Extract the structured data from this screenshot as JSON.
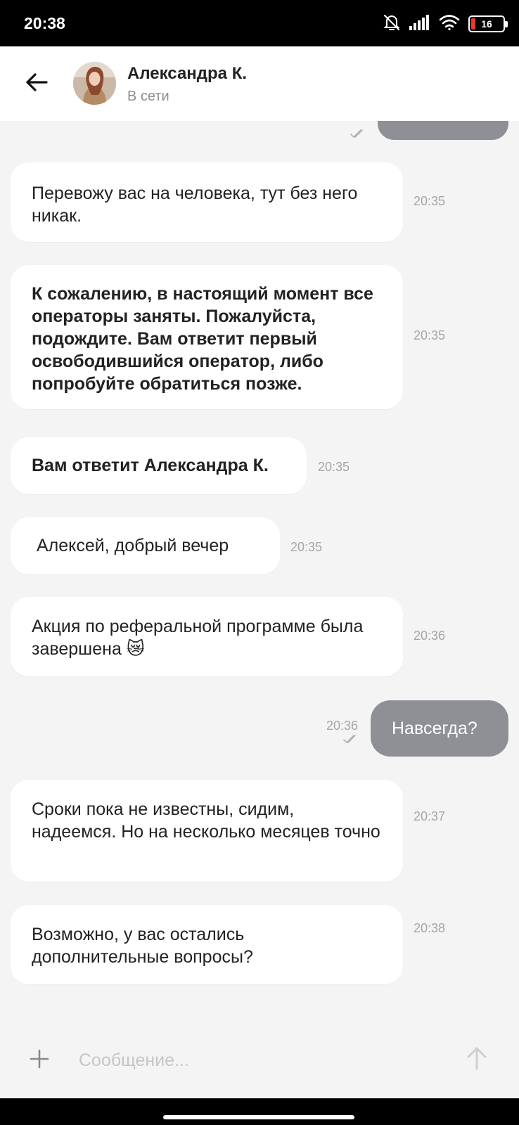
{
  "status_bar": {
    "time": "20:38",
    "battery_level": "16",
    "icons": [
      "bell-off-icon",
      "signal-icon",
      "wifi-icon",
      "battery-icon"
    ]
  },
  "header": {
    "contact_name": "Александра К.",
    "contact_status": "В сети",
    "back_icon": "arrow-left-icon"
  },
  "messages": [
    {
      "direction": "out",
      "text": "",
      "partially_visible": true
    },
    {
      "direction": "in",
      "text": "Перевожу вас на человека, тут без него никак.",
      "time": "20:35",
      "bold": false
    },
    {
      "direction": "in",
      "text": "К сожалению, в настоящий момент все операторы заняты. Пожалуйста, подождите. Вам ответит первый освободившийся оператор, либо попробуйте обратиться позже.",
      "time": "20:35",
      "bold": true
    },
    {
      "direction": "in",
      "text": "Вам ответит Александра К.",
      "time": "20:35",
      "bold": true
    },
    {
      "direction": "in",
      "text": "Алексей, добрый вечер",
      "time": "20:35",
      "bold": false
    },
    {
      "direction": "in",
      "text": "Акция по реферальной программе была завершена 😿",
      "time": "20:36",
      "bold": false
    },
    {
      "direction": "out",
      "text": "Навсегда?",
      "time": "20:36",
      "read": true
    },
    {
      "direction": "in",
      "text": "Сроки пока не известны, сидим, надеемся. Но на несколько месяцев точно",
      "time": "20:37",
      "bold": false
    },
    {
      "direction": "in",
      "text": "Возможно, у вас остались дополнительные вопросы?",
      "time": "20:38",
      "bold": false
    }
  ],
  "composer": {
    "placeholder": "Сообщение...",
    "value": "",
    "attach_icon": "plus-icon",
    "send_icon": "arrow-up-icon"
  },
  "colors": {
    "background": "#f4f4f4",
    "incoming_bubble": "#ffffff",
    "outgoing_bubble": "#8e9096",
    "timestamp": "#a6a6a6"
  }
}
